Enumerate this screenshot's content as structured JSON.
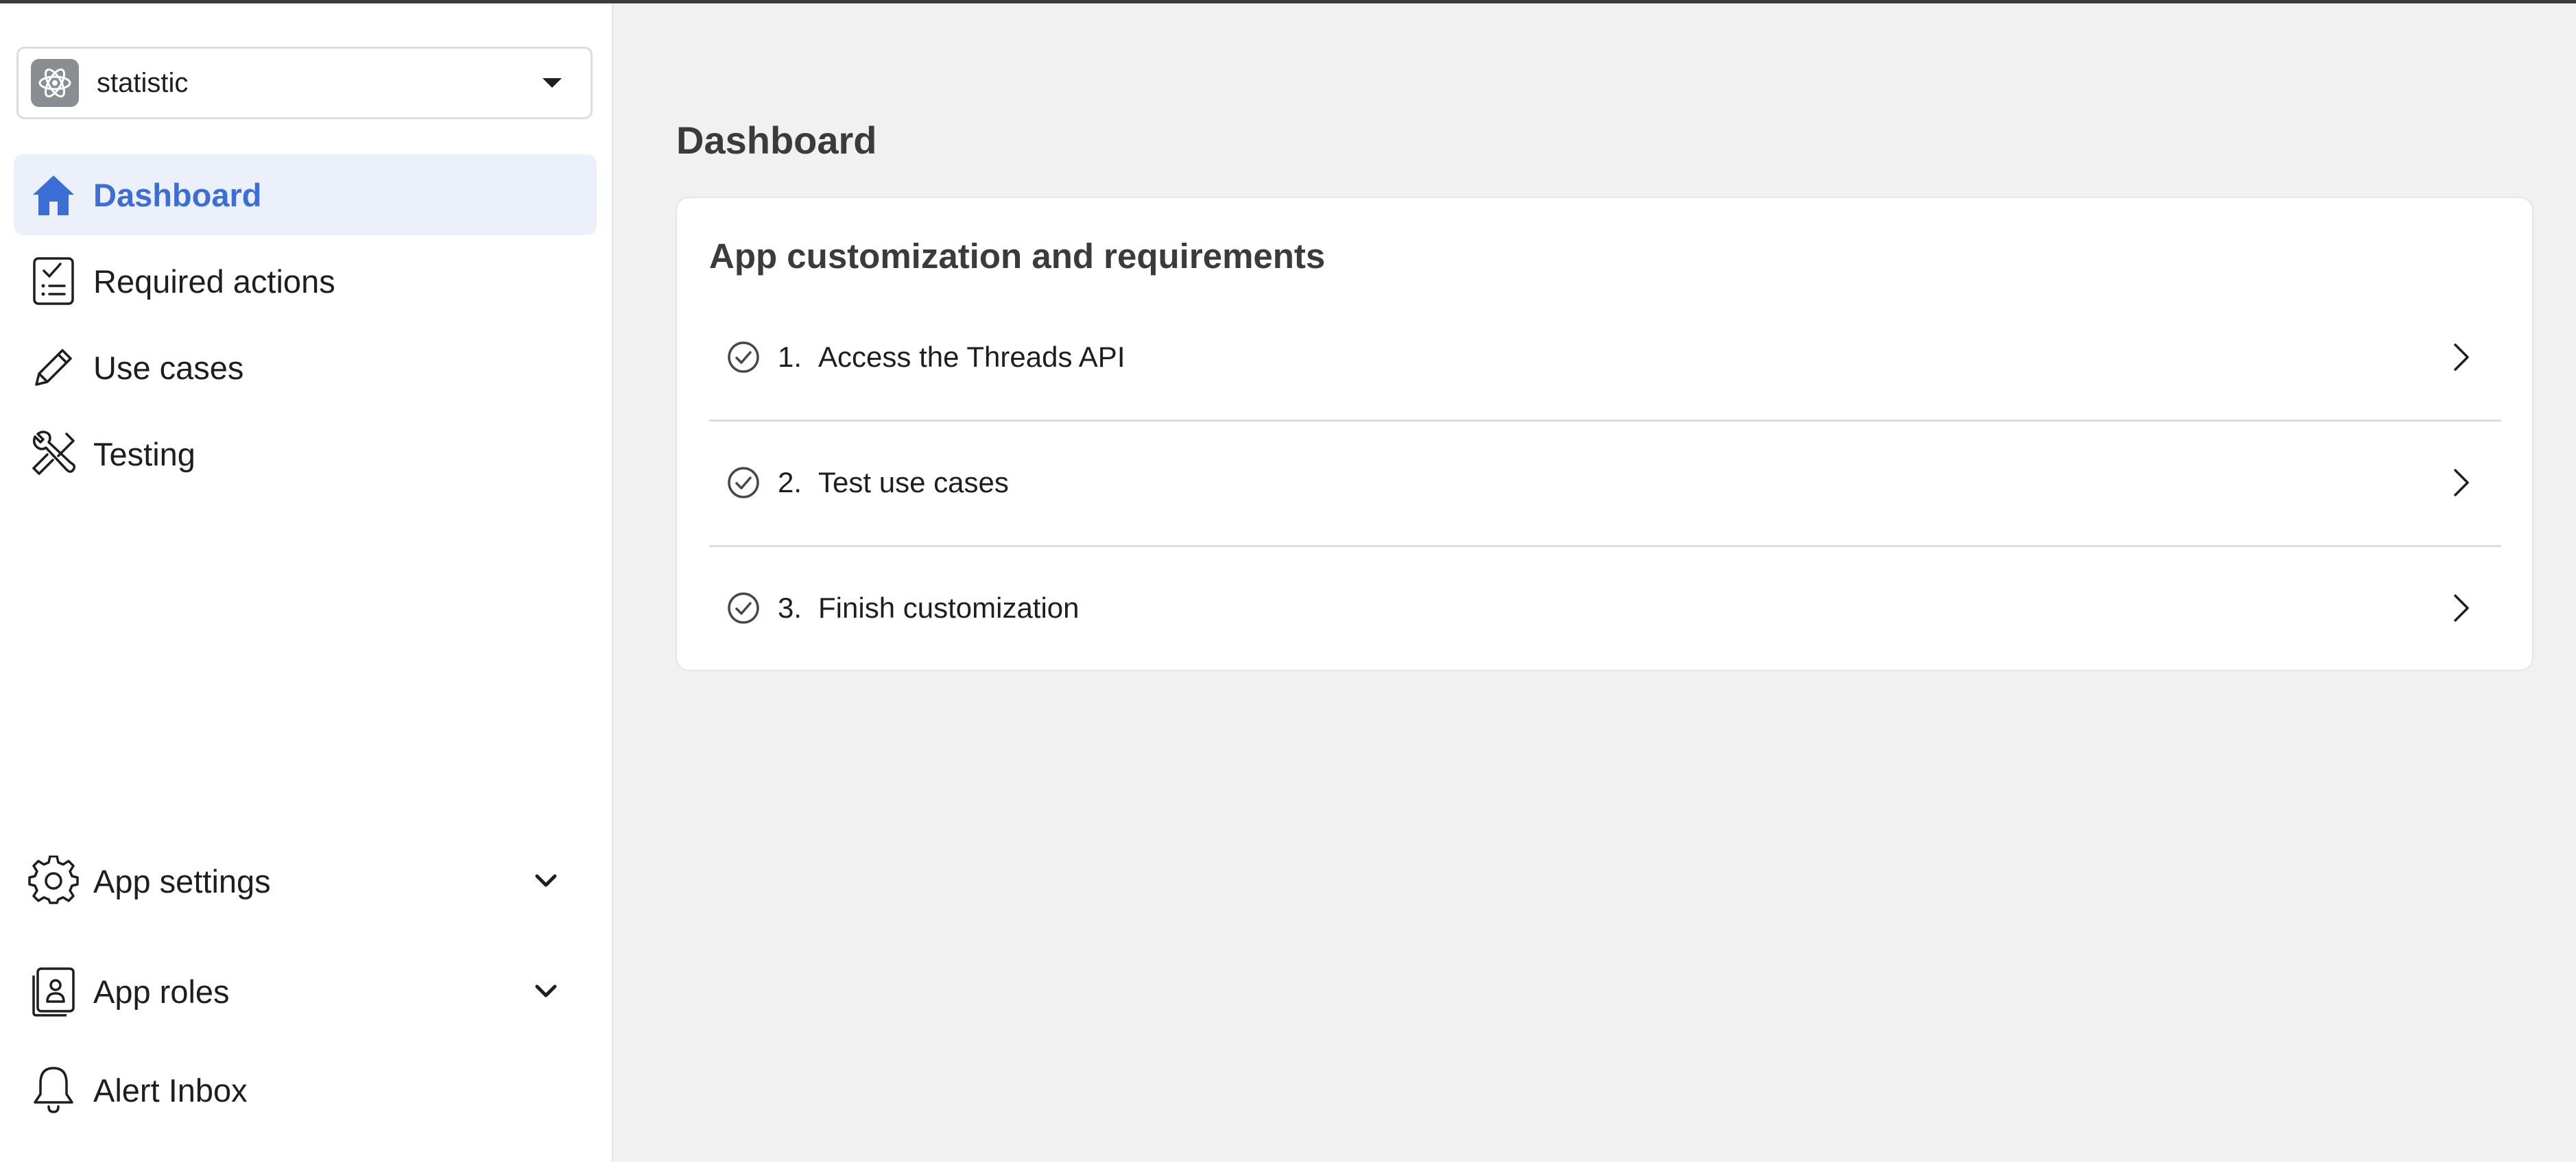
{
  "app_selector": {
    "name": "statistic",
    "icon": "atom-icon"
  },
  "sidebar": {
    "items": [
      {
        "label": "Dashboard",
        "icon": "home-icon",
        "active": true
      },
      {
        "label": "Required actions",
        "icon": "checklist-icon"
      },
      {
        "label": "Use cases",
        "icon": "pencil-icon"
      },
      {
        "label": "Testing",
        "icon": "tools-icon"
      }
    ],
    "bottom_items": [
      {
        "label": "App settings",
        "icon": "gear-icon",
        "expandable": true
      },
      {
        "label": "App roles",
        "icon": "id-badge-icon",
        "expandable": true
      },
      {
        "label": "Alert Inbox",
        "icon": "bell-icon"
      }
    ]
  },
  "main": {
    "title": "Dashboard",
    "card": {
      "title": "App customization and requirements",
      "steps": [
        {
          "number": "1.",
          "label": "Access the Threads API"
        },
        {
          "number": "2.",
          "label": "Test use cases"
        },
        {
          "number": "3.",
          "label": "Finish customization"
        }
      ]
    }
  },
  "colors": {
    "accent": "#3b6fd6",
    "active_bg": "#ebf0fb",
    "main_bg": "#f1f1f1"
  }
}
